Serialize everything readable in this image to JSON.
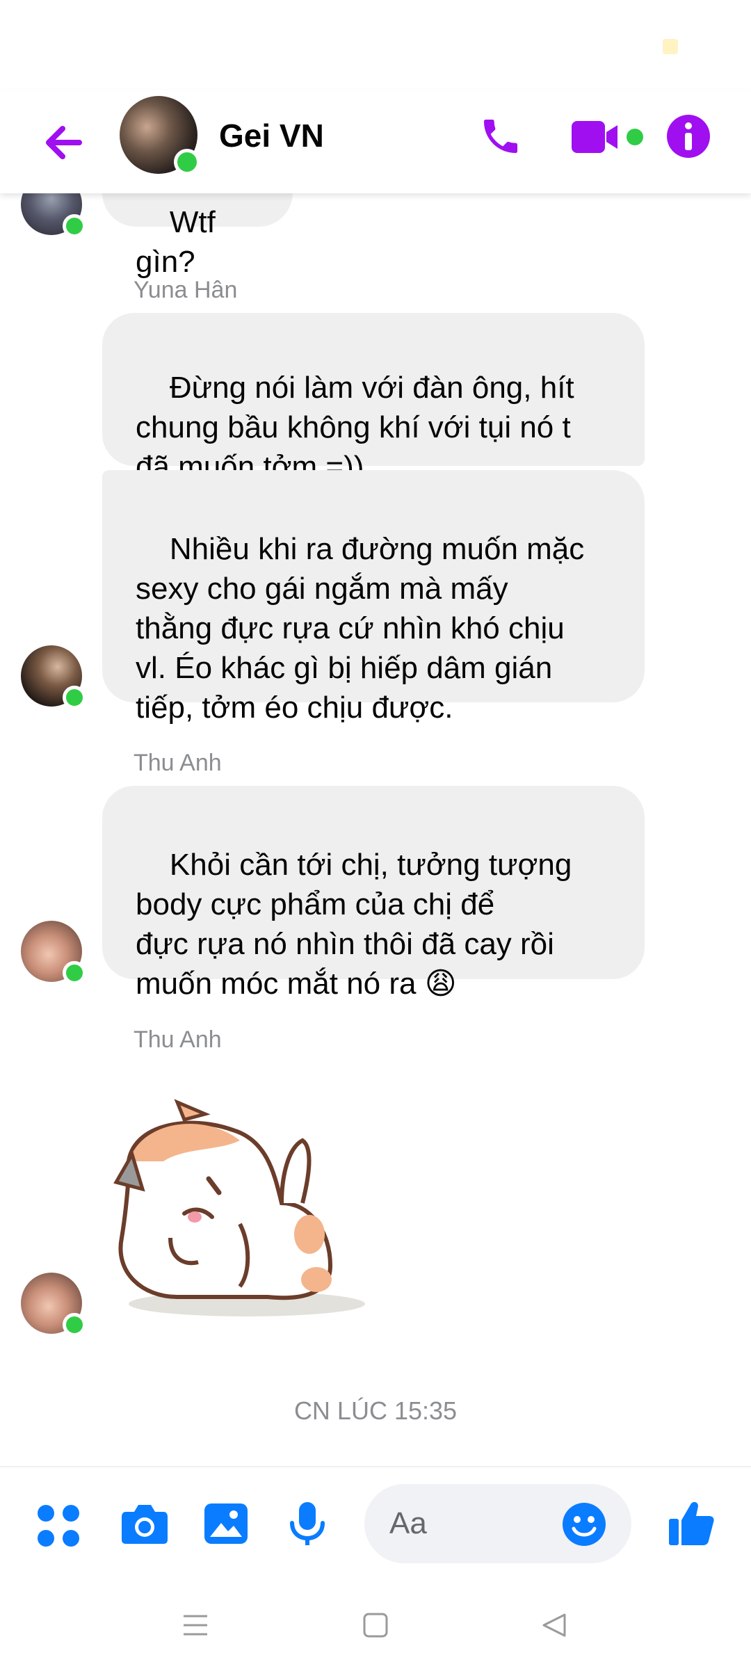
{
  "header": {
    "title": "Gei VN"
  },
  "messages": {
    "partial_text": "Wtf gìn?",
    "group1_sender": "Yuna Hân",
    "group1_bubble1": "Đừng nói làm với đàn ông, hít\nchung bầu không khí với tụi nó t\nđã muốn tởm =))",
    "group1_bubble2": "Nhiều khi ra đường muốn mặc\nsexy cho gái ngắm mà mấy\nthằng đực rựa cứ nhìn khó chịu\nvl. Éo khác gì bị hiếp dâm gián\ntiếp, tởm éo chịu được.",
    "group2_sender": "Thu Anh",
    "group2_bubble1": "Khỏi cần tới chị, tưởng tượng\nbody cực phẩm của chị để\nđực rựa nó nhìn thôi đã cay rồi\nmuốn móc mắt nó ra 😩",
    "group3_sender": "Thu Anh",
    "timestamp": "CN LÚC 15:35"
  },
  "composer": {
    "placeholder": "Aa"
  },
  "icons": {
    "back": "arrow-left",
    "call": "phone",
    "video": "video-camera",
    "info": "info-circle",
    "more": "four-dots-grid",
    "camera": "camera",
    "gallery": "image",
    "mic": "microphone",
    "emoji": "smiley",
    "like": "thumbs-up"
  },
  "colors": {
    "header_accent": "#a00ff0",
    "composer_accent": "#0a7cff",
    "bubble_bg": "#efefef",
    "online": "#31cc46"
  }
}
